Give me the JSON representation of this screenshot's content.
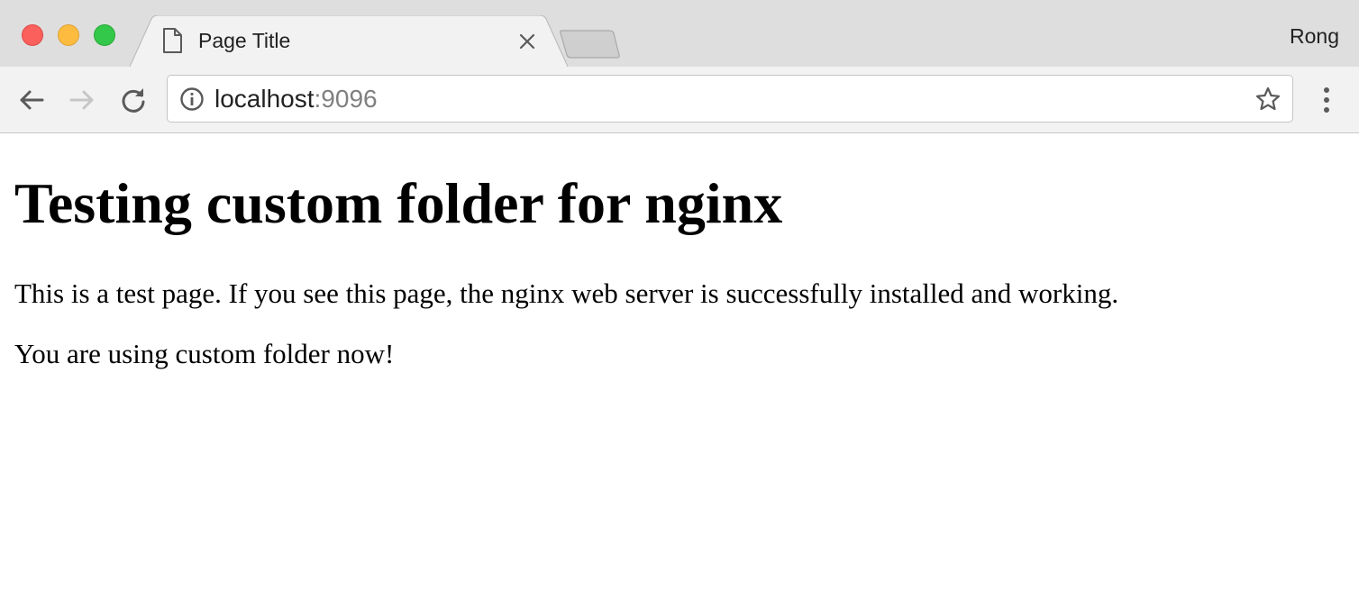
{
  "window": {
    "profile_name": "Rong",
    "traffic_lights": {
      "close_color": "#fc605c",
      "minimize_color": "#fdbc40",
      "maximize_color": "#34c84a"
    }
  },
  "tabs": [
    {
      "title": "Page Title",
      "icon": "page-icon",
      "active": true
    }
  ],
  "toolbar": {
    "back_icon": "back-arrow-icon",
    "forward_icon": "forward-arrow-icon",
    "forward_enabled": false,
    "reload_icon": "reload-icon",
    "menu_icon": "kebab-menu-icon"
  },
  "address_bar": {
    "info_icon": "info-icon",
    "host": "localhost",
    "port": ":9096",
    "bookmark_icon": "star-icon"
  },
  "page": {
    "heading": "Testing custom folder for nginx",
    "paragraphs": [
      "This is a test page. If you see this page, the nginx web server is successfully installed and working.",
      "You are using custom folder now!"
    ]
  }
}
